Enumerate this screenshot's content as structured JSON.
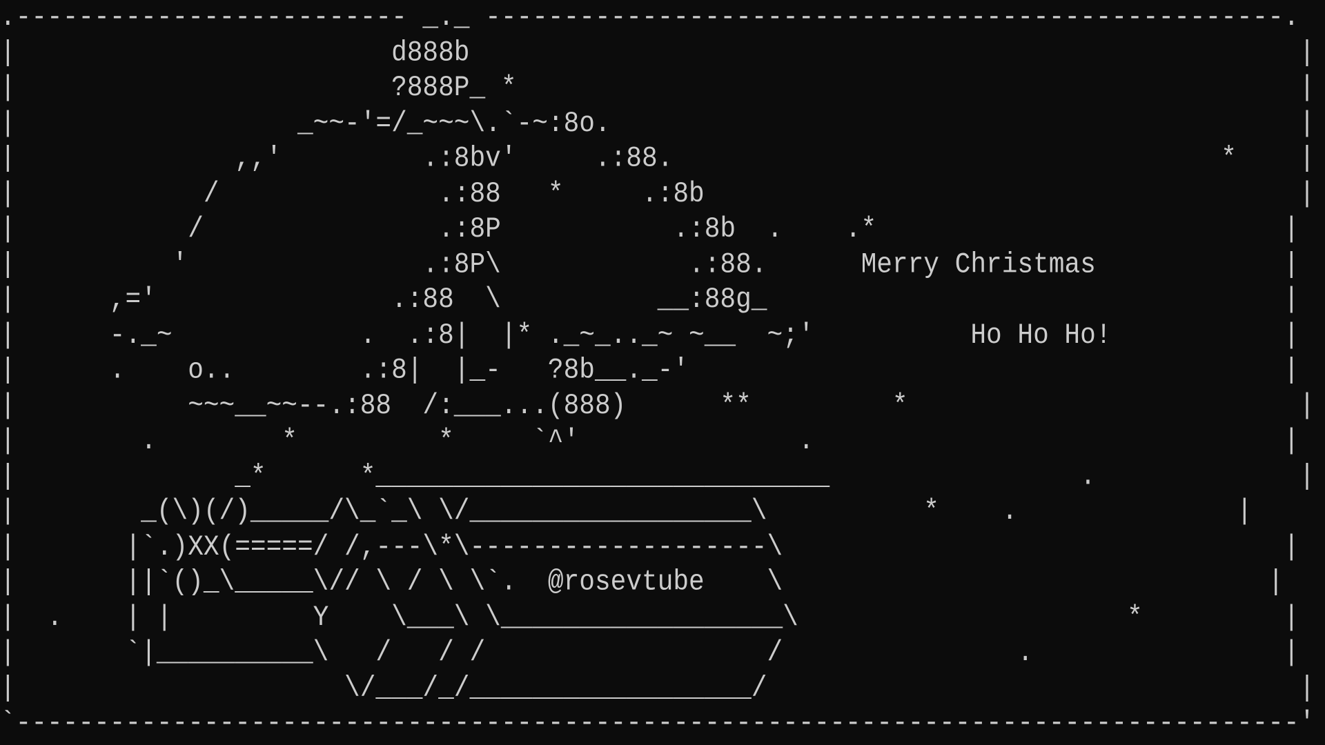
{
  "colors": {
    "background": "#0c0c0c",
    "text": "#cccccc"
  },
  "greeting": {
    "line1": "Merry Christmas",
    "line2": "Ho Ho Ho!"
  },
  "signature": "@rosevtube",
  "art_lines": [
    ".------------------------- _._ ---------------------------------------------------.",
    "|                        d888b                                                     |",
    "|                        ?888P_ *                                                  |",
    "|                  _~~-'=/_~~~\\.`-~:8o.                                            |",
    "|              ,,'         .:8bv'     .:88.                                   *    |",
    "|            /              .:88   *     .:8b                                      |",
    "|           /               .:8P           .:8b  .    .*                          |",
    "|          '               .:8P\\            .:88.      Merry Christmas            |",
    "|      ,='               .:88  \\          __:88g_                                 |",
    "|      -._~            .  .:8|  |* ._~_.._~ ~__  ~;'          Ho Ho Ho!           |",
    "|      .    o..        .:8|  |_-   ?8b__._-'                                      |",
    "|           ~~~__~~--.:88  /:___...(888)      **         *                         |",
    "|        .        *         *     `^'              .                              |",
    "|              _*      *_____________________________                .             |",
    "|        _(\\)(/)_____/\\_`_\\ \\/__________________\\          *    .              |",
    "|       |`.)XX(=====/ /,---\\*\\-------------------\\                                |",
    "|       ||`()_\\_____\\// \\ / \\ \\`.  @rosevtube    \\                               |",
    "|  .    | |         Y    \\___\\ \\__________________\\                     *         |",
    "|       `|__________\\   /   / /                  /               .                |",
    "|                     \\/___/_/__________________/                                  |",
    "`----------------------------------------------------------------------------------'"
  ]
}
